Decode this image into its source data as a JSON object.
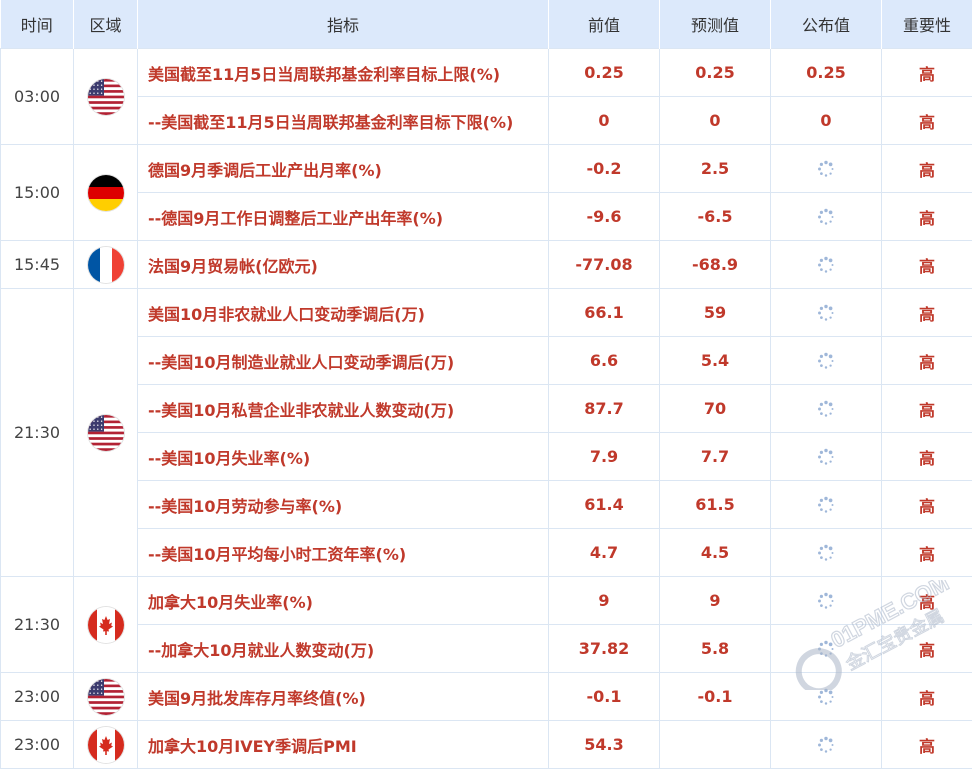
{
  "headers": {
    "time": "时间",
    "region": "区域",
    "indicator": "指标",
    "previous": "前值",
    "forecast": "预测值",
    "actual": "公布值",
    "importance": "重要性"
  },
  "groups": [
    {
      "time": "03:00",
      "flag": "us",
      "rows": [
        {
          "indicator": "美国截至11月5日当周联邦基金利率目标上限(%)",
          "previous": "0.25",
          "forecast": "0.25",
          "actual": "0.25",
          "importance": "高"
        },
        {
          "indicator": "--美国截至11月5日当周联邦基金利率目标下限(%)",
          "previous": "0",
          "forecast": "0",
          "actual": "0",
          "importance": "高"
        }
      ]
    },
    {
      "time": "15:00",
      "flag": "de",
      "rows": [
        {
          "indicator": "德国9月季调后工业产出月率(%)",
          "previous": "-0.2",
          "forecast": "2.5",
          "actual": "",
          "importance": "高"
        },
        {
          "indicator": "--德国9月工作日调整后工业产出年率(%)",
          "previous": "-9.6",
          "forecast": "-6.5",
          "actual": "",
          "importance": "高"
        }
      ]
    },
    {
      "time": "15:45",
      "flag": "fr",
      "rows": [
        {
          "indicator": "法国9月贸易帐(亿欧元)",
          "previous": "-77.08",
          "forecast": "-68.9",
          "actual": "",
          "importance": "高"
        }
      ]
    },
    {
      "time": "21:30",
      "flag": "us",
      "rows": [
        {
          "indicator": "美国10月非农就业人口变动季调后(万)",
          "previous": "66.1",
          "forecast": "59",
          "actual": "",
          "importance": "高"
        },
        {
          "indicator": "--美国10月制造业就业人口变动季调后(万)",
          "previous": "6.6",
          "forecast": "5.4",
          "actual": "",
          "importance": "高"
        },
        {
          "indicator": "--美国10月私营企业非农就业人数变动(万)",
          "previous": "87.7",
          "forecast": "70",
          "actual": "",
          "importance": "高"
        },
        {
          "indicator": "--美国10月失业率(%)",
          "previous": "7.9",
          "forecast": "7.7",
          "actual": "",
          "importance": "高"
        },
        {
          "indicator": "--美国10月劳动参与率(%)",
          "previous": "61.4",
          "forecast": "61.5",
          "actual": "",
          "importance": "高"
        },
        {
          "indicator": "--美国10月平均每小时工资年率(%)",
          "previous": "4.7",
          "forecast": "4.5",
          "actual": "",
          "importance": "高"
        }
      ]
    },
    {
      "time": "21:30",
      "flag": "ca",
      "rows": [
        {
          "indicator": "加拿大10月失业率(%)",
          "previous": "9",
          "forecast": "9",
          "actual": "",
          "importance": "高"
        },
        {
          "indicator": "--加拿大10月就业人数变动(万)",
          "previous": "37.82",
          "forecast": "5.8",
          "actual": "",
          "importance": "高"
        }
      ]
    },
    {
      "time": "23:00",
      "flag": "us",
      "rows": [
        {
          "indicator": "美国9月批发库存月率终值(%)",
          "previous": "-0.1",
          "forecast": "-0.1",
          "actual": "",
          "importance": "高"
        }
      ]
    },
    {
      "time": "23:00",
      "flag": "ca",
      "rows": [
        {
          "indicator": "加拿大10月IVEY季调后PMI",
          "previous": "54.3",
          "forecast": "",
          "actual": "",
          "importance": "高"
        }
      ]
    }
  ],
  "icons": {
    "us": "us-flag-icon",
    "de": "germany-flag-icon",
    "fr": "france-flag-icon",
    "ca": "canada-flag-icon",
    "pending": "loading-spinner-icon"
  },
  "colors": {
    "header_bg": "#dce9fb",
    "value_red": "#c0392b",
    "grid": "#dbe6f3",
    "separator": "#c77a7a"
  },
  "watermark": {
    "url_text": "01PME.COM",
    "brand_text": "金汇宝贵金属"
  }
}
